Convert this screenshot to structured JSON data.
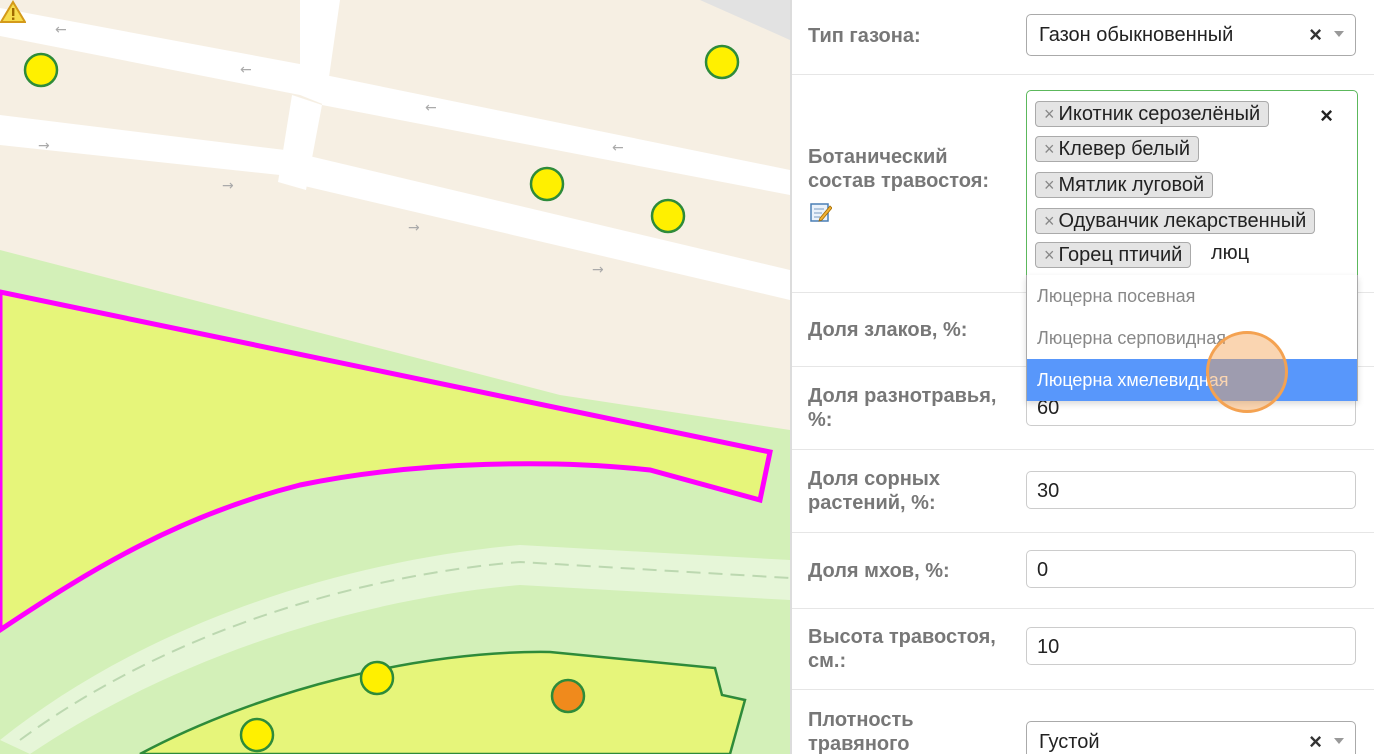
{
  "map": {
    "markers": {
      "yellow_fill": "#fff000",
      "orange_fill": "#f08a1c",
      "stroke": "#2e8b3a"
    },
    "colors": {
      "boundary": "#ff00ff",
      "urban_area": "#f6efe3",
      "road": "#ffffff",
      "lawn": "#e6f57a",
      "green_zone": "#d3f0b8"
    },
    "warning_icon": "warning-icon"
  },
  "form": {
    "lawn_type": {
      "label": "Тип газона:",
      "value": "Газон обыкновенный",
      "clear": "×"
    },
    "botanical": {
      "label_line1": "Ботанический",
      "label_line2": "состав травостоя:",
      "tags": [
        {
          "x": "×",
          "text": "Икотник серозелёный"
        },
        {
          "x": "×",
          "text": "Клевер белый"
        },
        {
          "x": "×",
          "text": "Мятлик луговой"
        },
        {
          "x": "×",
          "text": "Одуванчик лекарственный"
        },
        {
          "x": "×",
          "text": "Горец птичий"
        }
      ],
      "typed": "люц",
      "clear": "×",
      "options": [
        "Люцерна посевная",
        "Люцерна серповидная",
        "Люцерна хмелевидная"
      ],
      "highlighted_index": 2
    },
    "cereals": {
      "label": "Доля злаков, %:"
    },
    "forbs": {
      "label_line1": "Доля разнотравья,",
      "label_line2": "%:",
      "value": "60"
    },
    "weeds": {
      "label_line1": "Доля сорных",
      "label_line2": "растений, %:",
      "value": "30"
    },
    "moss": {
      "label": "Доля мхов, %:",
      "value": "0"
    },
    "height": {
      "label_line1": "Высота травостоя,",
      "label_line2": "см.:",
      "value": "10"
    },
    "density": {
      "label_line1": "Плотность",
      "label_line2": "травяного",
      "value": "Густой",
      "clear": "×"
    }
  }
}
